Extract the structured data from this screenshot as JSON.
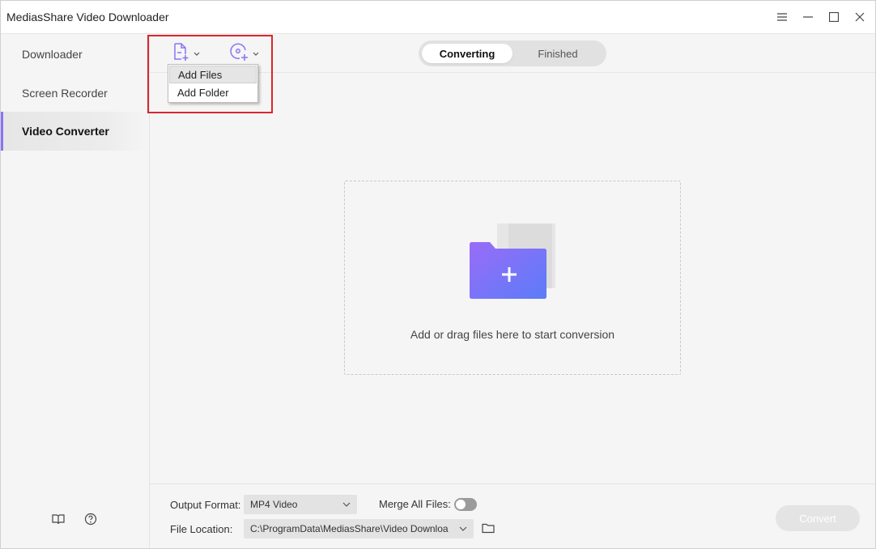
{
  "app": {
    "title": "MediasShare Video Downloader"
  },
  "window_controls": [
    "menu-icon",
    "minimize-icon",
    "maximize-icon",
    "close-icon"
  ],
  "sidebar": {
    "items": [
      {
        "label": "Downloader",
        "active": false
      },
      {
        "label": "Screen Recorder",
        "active": false
      },
      {
        "label": "Video Converter",
        "active": true
      }
    ],
    "bottom_icons": [
      "book-icon",
      "help-icon"
    ]
  },
  "toolbar": {
    "add_file_icon": "add-file-icon",
    "add_disc_icon": "add-disc-icon",
    "tabs": [
      {
        "label": "Converting",
        "active": true
      },
      {
        "label": "Finished",
        "active": false
      }
    ]
  },
  "dropdown": {
    "items": [
      {
        "label": "Add Files",
        "hovered": true
      },
      {
        "label": "Add Folder",
        "hovered": false
      }
    ]
  },
  "dropzone": {
    "text": "Add or drag files here to start conversion"
  },
  "bottom": {
    "output_format_label": "Output Format:",
    "output_format_value": "MP4 Video",
    "merge_label": "Merge All Files:",
    "merge_enabled": false,
    "file_location_label": "File Location:",
    "file_location_value": "C:\\ProgramData\\MediasShare\\Video Downloa",
    "convert_label": "Convert"
  },
  "colors": {
    "accent": "#8b74f5",
    "highlight": "#d9262c",
    "folder_from": "#9a6cf7",
    "folder_to": "#5b7cf8"
  }
}
